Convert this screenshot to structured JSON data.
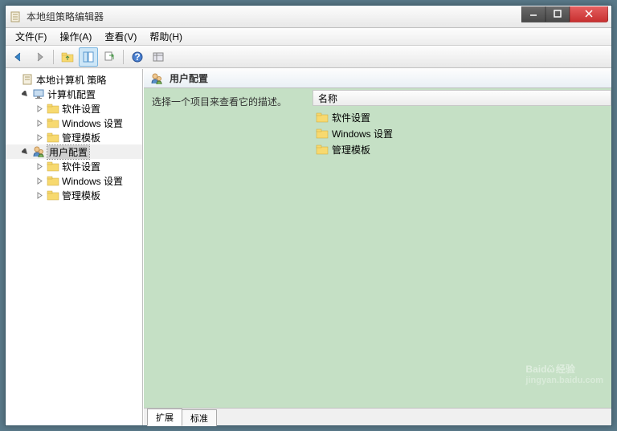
{
  "window": {
    "title": "本地组策略编辑器"
  },
  "menu": {
    "file": "文件(F)",
    "action": "操作(A)",
    "view": "查看(V)",
    "help": "帮助(H)"
  },
  "tree": {
    "root": "本地计算机 策略",
    "computer": "计算机配置",
    "user": "用户配置",
    "software": "软件设置",
    "windows": "Windows 设置",
    "admin": "管理模板"
  },
  "panel": {
    "header": "用户配置",
    "hint": "选择一个项目来查看它的描述。",
    "col_name": "名称"
  },
  "items": {
    "software": "软件设置",
    "windows": "Windows 设置",
    "admin": "管理模板"
  },
  "tabs": {
    "extended": "扩展",
    "standard": "标准"
  },
  "watermark": {
    "brand": "Baid",
    "suffix": "经验",
    "url": "jingyan.baidu.com"
  }
}
